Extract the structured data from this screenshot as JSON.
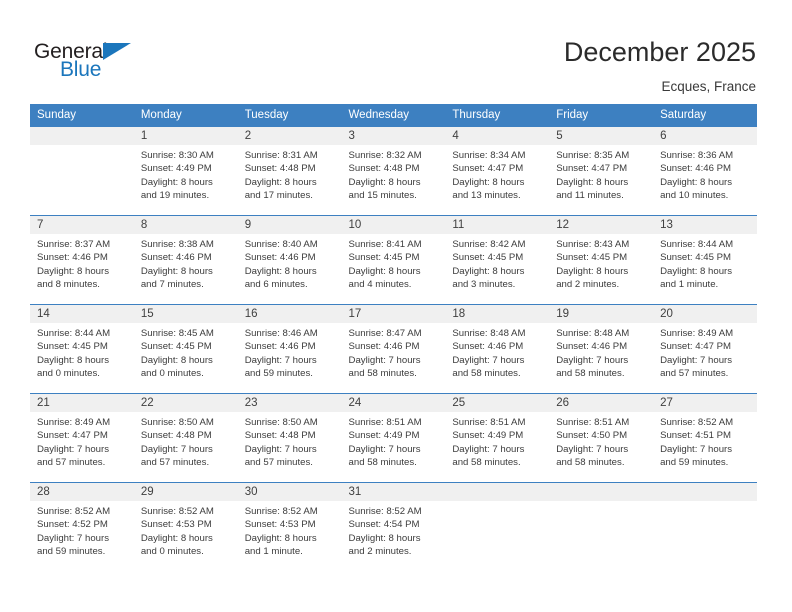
{
  "brand": {
    "name_part1": "General",
    "name_part2": "Blue",
    "accent_color": "#1b76bc"
  },
  "header": {
    "title": "December 2025",
    "subtitle": "Ecques, France"
  },
  "calendar": {
    "header_color": "#3d80c1",
    "weekday_headers": [
      "Sunday",
      "Monday",
      "Tuesday",
      "Wednesday",
      "Thursday",
      "Friday",
      "Saturday"
    ],
    "weeks": [
      [
        {
          "day": "",
          "lines": []
        },
        {
          "day": "1",
          "lines": [
            "Sunrise: 8:30 AM",
            "Sunset: 4:49 PM",
            "Daylight: 8 hours",
            "and 19 minutes."
          ]
        },
        {
          "day": "2",
          "lines": [
            "Sunrise: 8:31 AM",
            "Sunset: 4:48 PM",
            "Daylight: 8 hours",
            "and 17 minutes."
          ]
        },
        {
          "day": "3",
          "lines": [
            "Sunrise: 8:32 AM",
            "Sunset: 4:48 PM",
            "Daylight: 8 hours",
            "and 15 minutes."
          ]
        },
        {
          "day": "4",
          "lines": [
            "Sunrise: 8:34 AM",
            "Sunset: 4:47 PM",
            "Daylight: 8 hours",
            "and 13 minutes."
          ]
        },
        {
          "day": "5",
          "lines": [
            "Sunrise: 8:35 AM",
            "Sunset: 4:47 PM",
            "Daylight: 8 hours",
            "and 11 minutes."
          ]
        },
        {
          "day": "6",
          "lines": [
            "Sunrise: 8:36 AM",
            "Sunset: 4:46 PM",
            "Daylight: 8 hours",
            "and 10 minutes."
          ]
        }
      ],
      [
        {
          "day": "7",
          "lines": [
            "Sunrise: 8:37 AM",
            "Sunset: 4:46 PM",
            "Daylight: 8 hours",
            "and 8 minutes."
          ]
        },
        {
          "day": "8",
          "lines": [
            "Sunrise: 8:38 AM",
            "Sunset: 4:46 PM",
            "Daylight: 8 hours",
            "and 7 minutes."
          ]
        },
        {
          "day": "9",
          "lines": [
            "Sunrise: 8:40 AM",
            "Sunset: 4:46 PM",
            "Daylight: 8 hours",
            "and 6 minutes."
          ]
        },
        {
          "day": "10",
          "lines": [
            "Sunrise: 8:41 AM",
            "Sunset: 4:45 PM",
            "Daylight: 8 hours",
            "and 4 minutes."
          ]
        },
        {
          "day": "11",
          "lines": [
            "Sunrise: 8:42 AM",
            "Sunset: 4:45 PM",
            "Daylight: 8 hours",
            "and 3 minutes."
          ]
        },
        {
          "day": "12",
          "lines": [
            "Sunrise: 8:43 AM",
            "Sunset: 4:45 PM",
            "Daylight: 8 hours",
            "and 2 minutes."
          ]
        },
        {
          "day": "13",
          "lines": [
            "Sunrise: 8:44 AM",
            "Sunset: 4:45 PM",
            "Daylight: 8 hours",
            "and 1 minute."
          ]
        }
      ],
      [
        {
          "day": "14",
          "lines": [
            "Sunrise: 8:44 AM",
            "Sunset: 4:45 PM",
            "Daylight: 8 hours",
            "and 0 minutes."
          ]
        },
        {
          "day": "15",
          "lines": [
            "Sunrise: 8:45 AM",
            "Sunset: 4:45 PM",
            "Daylight: 8 hours",
            "and 0 minutes."
          ]
        },
        {
          "day": "16",
          "lines": [
            "Sunrise: 8:46 AM",
            "Sunset: 4:46 PM",
            "Daylight: 7 hours",
            "and 59 minutes."
          ]
        },
        {
          "day": "17",
          "lines": [
            "Sunrise: 8:47 AM",
            "Sunset: 4:46 PM",
            "Daylight: 7 hours",
            "and 58 minutes."
          ]
        },
        {
          "day": "18",
          "lines": [
            "Sunrise: 8:48 AM",
            "Sunset: 4:46 PM",
            "Daylight: 7 hours",
            "and 58 minutes."
          ]
        },
        {
          "day": "19",
          "lines": [
            "Sunrise: 8:48 AM",
            "Sunset: 4:46 PM",
            "Daylight: 7 hours",
            "and 58 minutes."
          ]
        },
        {
          "day": "20",
          "lines": [
            "Sunrise: 8:49 AM",
            "Sunset: 4:47 PM",
            "Daylight: 7 hours",
            "and 57 minutes."
          ]
        }
      ],
      [
        {
          "day": "21",
          "lines": [
            "Sunrise: 8:49 AM",
            "Sunset: 4:47 PM",
            "Daylight: 7 hours",
            "and 57 minutes."
          ]
        },
        {
          "day": "22",
          "lines": [
            "Sunrise: 8:50 AM",
            "Sunset: 4:48 PM",
            "Daylight: 7 hours",
            "and 57 minutes."
          ]
        },
        {
          "day": "23",
          "lines": [
            "Sunrise: 8:50 AM",
            "Sunset: 4:48 PM",
            "Daylight: 7 hours",
            "and 57 minutes."
          ]
        },
        {
          "day": "24",
          "lines": [
            "Sunrise: 8:51 AM",
            "Sunset: 4:49 PM",
            "Daylight: 7 hours",
            "and 58 minutes."
          ]
        },
        {
          "day": "25",
          "lines": [
            "Sunrise: 8:51 AM",
            "Sunset: 4:49 PM",
            "Daylight: 7 hours",
            "and 58 minutes."
          ]
        },
        {
          "day": "26",
          "lines": [
            "Sunrise: 8:51 AM",
            "Sunset: 4:50 PM",
            "Daylight: 7 hours",
            "and 58 minutes."
          ]
        },
        {
          "day": "27",
          "lines": [
            "Sunrise: 8:52 AM",
            "Sunset: 4:51 PM",
            "Daylight: 7 hours",
            "and 59 minutes."
          ]
        }
      ],
      [
        {
          "day": "28",
          "lines": [
            "Sunrise: 8:52 AM",
            "Sunset: 4:52 PM",
            "Daylight: 7 hours",
            "and 59 minutes."
          ]
        },
        {
          "day": "29",
          "lines": [
            "Sunrise: 8:52 AM",
            "Sunset: 4:53 PM",
            "Daylight: 8 hours",
            "and 0 minutes."
          ]
        },
        {
          "day": "30",
          "lines": [
            "Sunrise: 8:52 AM",
            "Sunset: 4:53 PM",
            "Daylight: 8 hours",
            "and 1 minute."
          ]
        },
        {
          "day": "31",
          "lines": [
            "Sunrise: 8:52 AM",
            "Sunset: 4:54 PM",
            "Daylight: 8 hours",
            "and 2 minutes."
          ]
        },
        {
          "day": "",
          "lines": []
        },
        {
          "day": "",
          "lines": []
        },
        {
          "day": "",
          "lines": []
        }
      ]
    ]
  }
}
